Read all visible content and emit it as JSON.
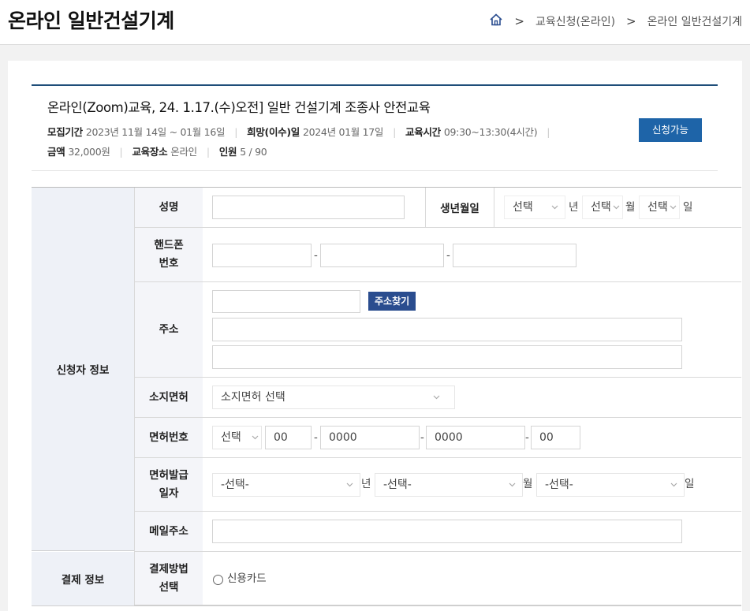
{
  "header": {
    "title": "온라인 일반건설기계",
    "breadcrumb": [
      "교육신청(온라인)",
      "온라인 일반건설기계"
    ],
    "home_icon": "home-icon"
  },
  "course": {
    "title": "온라인(Zoom)교육, 24. 1.17.(수)오전] 일반 건설기계 조종사 안전교육",
    "recruit_label": "모집기간",
    "recruit_value": "2023년 11월 14일 ~ 01월 16일",
    "desired_label": "희망(이수)일",
    "desired_value": "2024년 01월 17일",
    "time_label": "교육시간",
    "time_value": "09:30~13:30(4시간)",
    "fee_label": "금액",
    "fee_value": "32,000원",
    "place_label": "교육장소",
    "place_value": "온라인",
    "people_label": "인원",
    "people_value": "5 / 90",
    "status_button": "신청가능"
  },
  "form": {
    "applicant_section": "신청자 정보",
    "payment_section": "결제 정보",
    "name_label": "성명",
    "birth_label": "생년월일",
    "birth_year": "선택",
    "birth_month": "선택",
    "birth_day": "선택",
    "year_unit": "년",
    "month_unit": "월",
    "day_unit": "일",
    "phone_label_1": "핸드폰",
    "phone_label_2": "번호",
    "dash": "-",
    "address_label": "주소",
    "address_button": "주소찾기",
    "license_label": "소지면허",
    "license_select": "소지면허 선택",
    "license_no_label": "면허번호",
    "license_no_region": "선택",
    "license_no_1": "00",
    "license_no_2": "0000",
    "license_no_3": "0000",
    "license_no_4": "00",
    "issue_label_1": "면허발급",
    "issue_label_2": "일자",
    "issue_year": "-선택-",
    "issue_month": "-선택-",
    "issue_day": "-선택-",
    "email_label": "메일주소",
    "pay_label_1": "결제방법",
    "pay_label_2": "선택",
    "pay_option": "신용카드"
  }
}
